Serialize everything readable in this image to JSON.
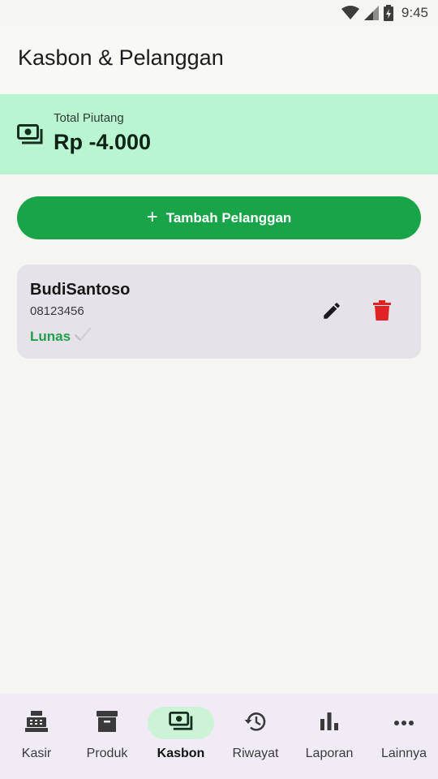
{
  "status_bar": {
    "time": "9:45"
  },
  "app_bar": {
    "title": "Kasbon & Pelanggan"
  },
  "summary": {
    "label": "Total Piutang",
    "amount": "Rp -4.000"
  },
  "actions": {
    "add_customer_label": "Tambah Pelanggan"
  },
  "customers": [
    {
      "name": "BudiSantoso",
      "phone": "08123456",
      "status": "Lunas"
    }
  ],
  "bottom_nav": {
    "items": [
      {
        "label": "Kasir",
        "icon": "cash-register-icon"
      },
      {
        "label": "Produk",
        "icon": "archive-box-icon"
      },
      {
        "label": "Kasbon",
        "icon": "money-icon"
      },
      {
        "label": "Riwayat",
        "icon": "history-icon"
      },
      {
        "label": "Laporan",
        "icon": "bar-chart-icon"
      },
      {
        "label": "Lainnya",
        "icon": "more-horiz-icon"
      }
    ],
    "active": "Kasbon"
  },
  "colors": {
    "primary": "#1aa44a",
    "summary_bg": "#baf5d1",
    "card_bg": "#e6e2ea",
    "delete": "#e02323",
    "status_paid": "#1fa04a",
    "nav_bg": "#f1ebf6",
    "nav_active": "#cdf3d6"
  }
}
